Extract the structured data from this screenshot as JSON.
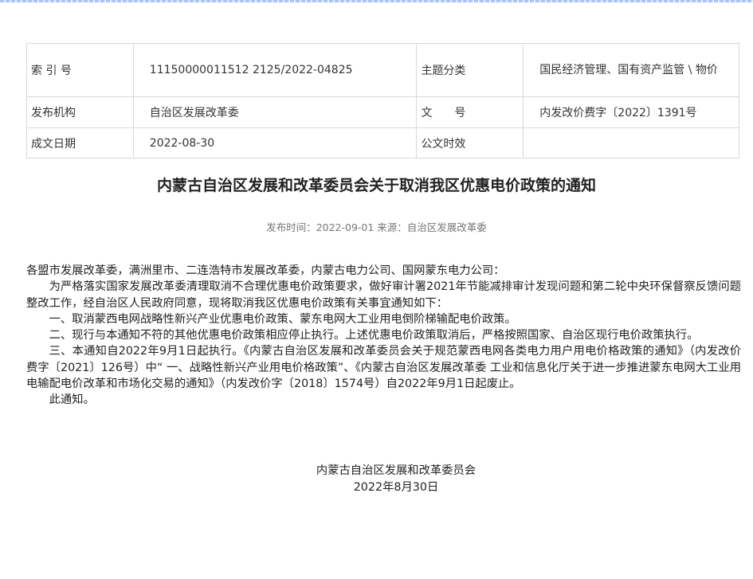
{
  "info_table": {
    "index_label": "索 引 号",
    "index_value": "11150000011512 2125/2022-04825",
    "topic_label": "主题分类",
    "topic_value": "国民经济管理、国有资产监管 \\ 物价",
    "org_label": "发布机构",
    "org_value": "自治区发展改革委",
    "doc_no_label": "文　　号",
    "doc_no_value": "内发改价费字〔2022〕1391号",
    "date_label": "成文日期",
    "date_value": "2022-08-30",
    "validity_label": "公文时效",
    "validity_value": ""
  },
  "title": "内蒙古自治区发展和改革委员会关于取消我区优惠电价政策的通知",
  "meta": "发布时间：2022-09-01  来源：自治区发展改革委",
  "body": {
    "salutation": "各盟市发展改革委，满洲里市、二连浩特市发展改革委，内蒙古电力公司、国网蒙东电力公司：",
    "paragraphs": [
      "为严格落实国家发展改革委清理取消不合理优惠电价政策要求，做好审计署2021年节能减排审计发现问题和第二轮中央环保督察反馈问题整改工作，经自治区人民政府同意，现将取消我区优惠电价政策有关事宜通知如下：",
      "一、取消蒙西电网战略性新兴产业优惠电价政策、蒙东电网大工业用电倒阶梯输配电价政策。",
      "二、现行与本通知不符的其他优惠电价政策相应停止执行。上述优惠电价政策取消后，严格按照国家、自治区现行电价政策执行。",
      "三、本通知自2022年9月1日起执行。《内蒙古自治区发展和改革委员会关于规范蒙西电网各类电力用户用电价格政策的通知》（内发改价费字〔2021〕126号）中“ 一、战略性新兴产业用电价格政策”、《内蒙古自治区发展改革委 工业和信息化厅关于进一步推进蒙东电网大工业用电输配电价改革和市场化交易的通知》（内发改价字〔2018〕1574号）自2022年9月1日起废止。",
      "此通知。"
    ]
  },
  "signature": {
    "org": "内蒙古自治区发展和改革委员会",
    "date": "2022年8月30日"
  }
}
